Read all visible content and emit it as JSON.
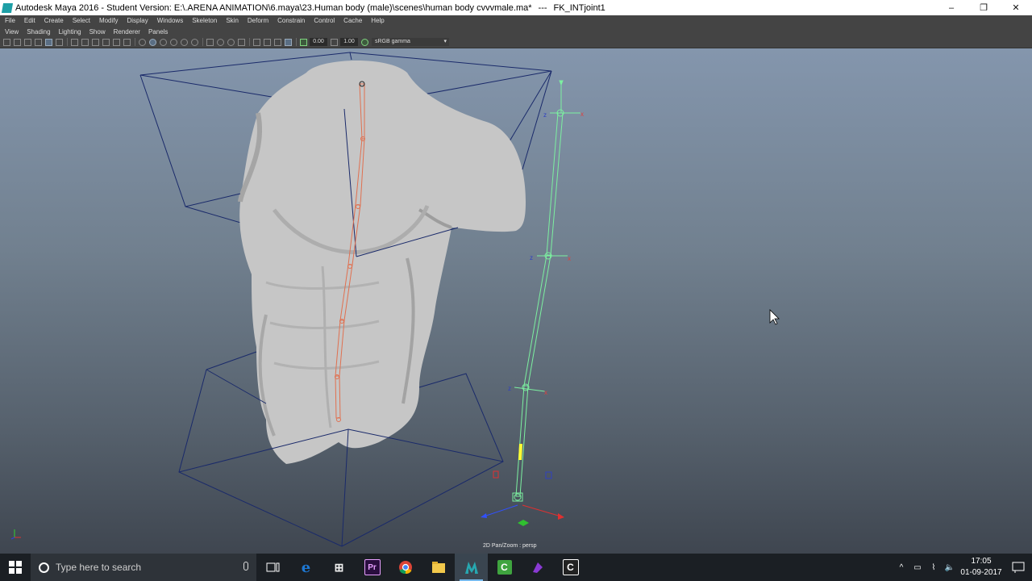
{
  "window": {
    "title": "Autodesk Maya 2016 - Student Version: E:\\.ARENA ANIMATION\\6.maya\\23.Human body (male)\\scenes\\human body cvvvmale.ma*",
    "separator": "---",
    "selection": "FK_INTjoint1",
    "buttons": [
      "–",
      "❐",
      "✕"
    ]
  },
  "menubar": {
    "items": [
      "File",
      "Edit",
      "Create",
      "Select",
      "Modify",
      "Display",
      "Windows",
      "Skeleton",
      "Skin",
      "Deform",
      "Constrain",
      "Control",
      "Cache",
      "Help"
    ]
  },
  "panel_menu": {
    "items": [
      "View",
      "Shading",
      "Lighting",
      "Show",
      "Renderer",
      "Panels"
    ]
  },
  "panel_toolbar": {
    "exposure": "0.00",
    "gamma": "1.00",
    "color_space": "sRGB gamma"
  },
  "viewport": {
    "camera_label": "2D Pan/Zoom : persp",
    "axis_labels": {
      "x": "x",
      "y": "y",
      "z": "z"
    },
    "colors": {
      "fk_chain": "#e07050",
      "ik_chain": "#7cf0a0",
      "cage": "#1a2a6a",
      "mesh": "#c6c6c6"
    }
  },
  "taskbar": {
    "search_placeholder": "Type here to search",
    "apps": [
      {
        "icon": "task-view-icon"
      },
      {
        "icon": "edge-icon",
        "label": "e",
        "color": "#1e78d4"
      },
      {
        "icon": "store-icon",
        "label": "⊞",
        "color": "#f0f0f0"
      },
      {
        "icon": "premiere-icon",
        "label": "Pr",
        "color": "#2a0e3f"
      },
      {
        "icon": "chrome-icon",
        "label": "",
        "color": "#db4437"
      },
      {
        "icon": "file-explorer-icon",
        "label": "",
        "color": "#f2c84b"
      },
      {
        "icon": "maya-icon",
        "label": "",
        "color": "#27a7b0"
      },
      {
        "icon": "camtasia-icon",
        "label": "C",
        "color": "#3fa43f"
      },
      {
        "icon": "app-purple-icon",
        "label": "",
        "color": "#8a3ad4"
      },
      {
        "icon": "camtasia-recorder-icon",
        "label": "C",
        "color": "#222"
      }
    ],
    "clock_time": "17:05",
    "clock_date": "01-09-2017"
  }
}
